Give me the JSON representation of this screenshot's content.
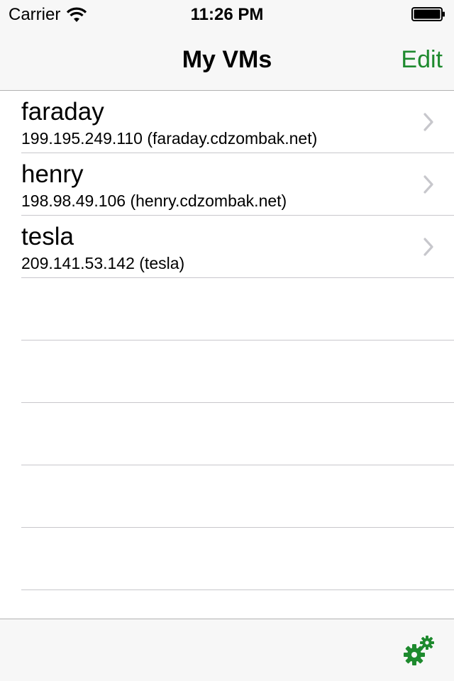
{
  "status_bar": {
    "carrier": "Carrier",
    "time": "11:26 PM",
    "wifi_icon": "wifi-icon",
    "battery_icon": "battery-icon"
  },
  "nav": {
    "title": "My VMs",
    "edit_label": "Edit"
  },
  "vms": [
    {
      "name": "faraday",
      "detail": "199.195.249.110 (faraday.cdzombak.net)"
    },
    {
      "name": "henry",
      "detail": "198.98.49.106 (henry.cdzombak.net)"
    },
    {
      "name": "tesla",
      "detail": "209.141.53.142 (tesla)"
    }
  ],
  "toolbar": {
    "settings_icon": "gears-icon"
  },
  "colors": {
    "accent": "#1e8a2e",
    "chrome_bg": "#f7f7f7",
    "separator": "#c8c7cc",
    "chevron": "#c7c7cc"
  }
}
